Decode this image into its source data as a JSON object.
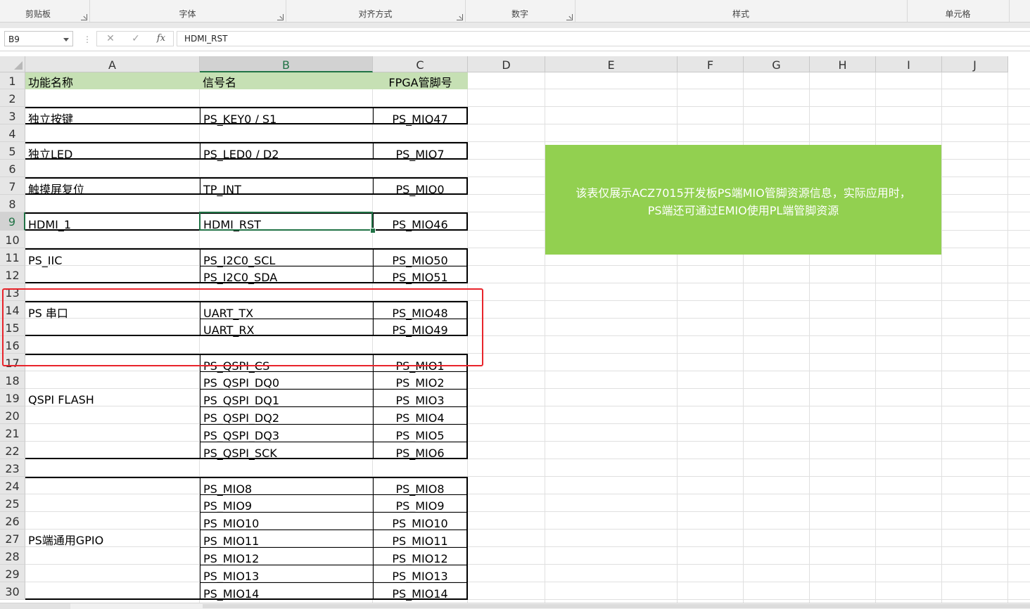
{
  "ribbon": {
    "groups": [
      {
        "label": "剪贴板"
      },
      {
        "label": "字体"
      },
      {
        "label": "对齐方式"
      },
      {
        "label": "数字"
      },
      {
        "label": "样式"
      },
      {
        "label": "单元格"
      }
    ]
  },
  "formula_bar": {
    "name_box": "B9",
    "cancel_symbol": "✕",
    "enter_symbol": "✓",
    "fx_label": "fx",
    "content": "HDMI_RST"
  },
  "columns": [
    "A",
    "B",
    "C",
    "D",
    "E",
    "F",
    "G",
    "H",
    "I",
    "J"
  ],
  "rows": [
    "1",
    "2",
    "3",
    "4",
    "5",
    "6",
    "7",
    "8",
    "9",
    "10",
    "11",
    "12",
    "13",
    "14",
    "15",
    "16",
    "17",
    "18",
    "19",
    "20",
    "21",
    "22",
    "23",
    "24",
    "25",
    "26",
    "27",
    "28",
    "29",
    "30"
  ],
  "active_cell": "B9",
  "cells": {
    "A1": "功能名称",
    "B1": "信号名",
    "C1": "FPGA管脚号",
    "A3": "独立按键",
    "B3": "PS_KEY0 / S1",
    "C3": "PS_MIO47",
    "A5": "独立LED",
    "B5": "PS_LED0 / D2",
    "C5": "PS_MIO7",
    "A7": "触摸屏复位",
    "B7": "TP_INT",
    "C7": "PS_MIO0",
    "A9": "HDMI_1",
    "B9": "HDMI_RST",
    "C9": "PS_MIO46",
    "A11": "PS_IIC",
    "B11": "PS_I2C0_SCL",
    "C11": "PS_MIO50",
    "B12": "PS_I2C0_SDA",
    "C12": "PS_MIO51",
    "A14": "PS 串口",
    "B14": "UART_TX",
    "C14": "PS_MIO48",
    "B15": "UART_RX",
    "C15": "PS_MIO49",
    "A19": "QSPI FLASH",
    "B17": "PS_QSPI_CS",
    "C17": "PS_MIO1",
    "B18": "PS_QSPI_DQ0",
    "C18": "PS_MIO2",
    "B19": "PS_QSPI_DQ1",
    "C19": "PS_MIO3",
    "B20": "PS_QSPI_DQ2",
    "C20": "PS_MIO4",
    "B21": "PS_QSPI_DQ3",
    "C21": "PS_MIO5",
    "B22": "PS_QSPI_SCK",
    "C22": "PS_MIO6",
    "A27": "PS端通用GPIO",
    "B24": "PS_MIO8",
    "C24": "PS_MIO8",
    "B25": "PS_MIO9",
    "C25": "PS_MIO9",
    "B26": "PS_MIO10",
    "C26": "PS_MIO10",
    "B27": "PS_MIO11",
    "C27": "PS_MIO11",
    "B28": "PS_MIO12",
    "C28": "PS_MIO12",
    "B29": "PS_MIO13",
    "C29": "PS_MIO13",
    "B30": "PS_MIO14",
    "C30": "PS_MIO14"
  },
  "note_box": {
    "line1": "该表仅展示ACZ7015开发板PS端MIO管脚资源信息，实际应用时，",
    "line2": "PS端还可通过EMIO使用PL端管脚资源"
  },
  "colors": {
    "header_fill": "#c6e0b4",
    "note_fill": "#92d050",
    "selection": "#217346",
    "highlight_box": "#e8242b"
  }
}
